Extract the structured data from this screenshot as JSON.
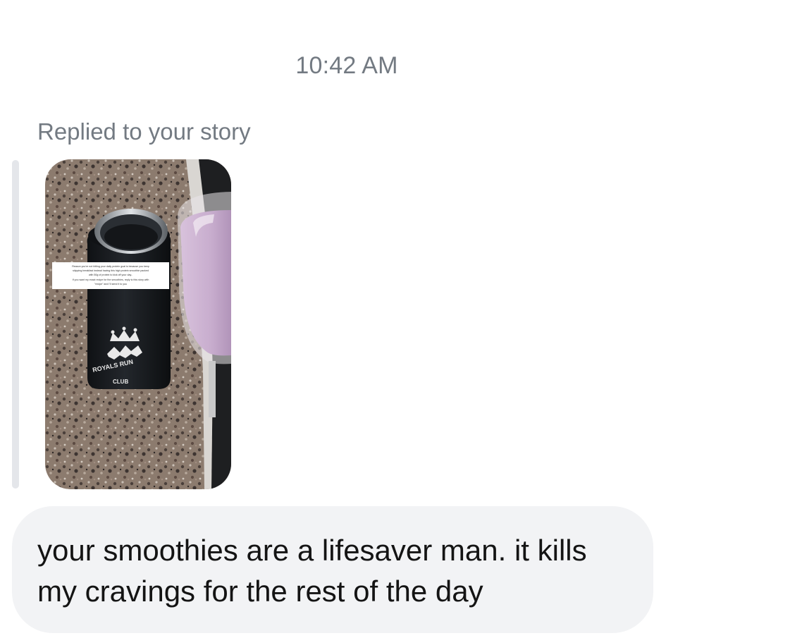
{
  "thread": {
    "timestamp": "10:42 AM",
    "reply_context": "Replied to your story",
    "story": {
      "thumbnail_icon": "story-photo-bottle-and-smoothie",
      "caption_lines": [
        "Reason you're not hitting your daily protein goal is because you keep",
        "skipping breakfast instead having this high protein smoothie packed",
        "with 50g of protein to kick off your day..",
        "If you want my exact recipe for the smoothies, reply to this story with",
        "\"recipe\" and I'll send it to you"
      ],
      "bottle_logo_text_top": "ROYALS RUN",
      "bottle_logo_text_bottom": "CLUB"
    },
    "message": {
      "text": "your smoothies are a lifesaver man. it kills my cravings for the rest of the day"
    },
    "colors": {
      "meta_text": "#737a82",
      "bubble_bg": "#f2f3f5",
      "reply_bar": "#e4e6ea"
    }
  }
}
